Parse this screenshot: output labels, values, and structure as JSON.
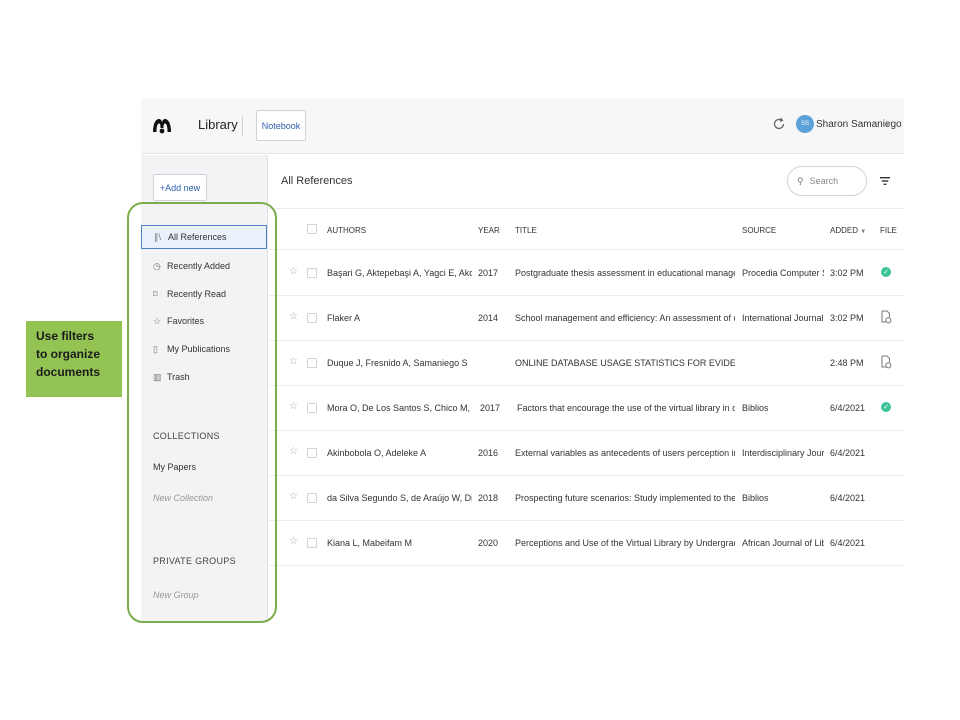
{
  "header": {
    "app_title": "Library",
    "notebook_label": "Notebook",
    "avatar_initials": "SS",
    "user_name": "Sharon Samaniego",
    "chevron": "∨"
  },
  "sidebar": {
    "add_new_label": "+Add new",
    "items": [
      {
        "label": "All References",
        "icon": "library-icon",
        "glyph": "∥\\"
      },
      {
        "label": "Recently Added",
        "icon": "clock-icon",
        "glyph": "◷"
      },
      {
        "label": "Recently Read",
        "icon": "bookmark-icon",
        "glyph": "⌑"
      },
      {
        "label": "Favorites",
        "icon": "star-icon",
        "glyph": "☆"
      },
      {
        "label": "My Publications",
        "icon": "document-icon",
        "glyph": "▯"
      },
      {
        "label": "Trash",
        "icon": "trash-icon",
        "glyph": "▥"
      }
    ],
    "collections_heading": "COLLECTIONS",
    "collections": [
      "My Papers"
    ],
    "new_collection": "New Collection",
    "groups_heading": "PRIVATE GROUPS",
    "new_group": "New Group"
  },
  "main": {
    "title": "All References",
    "search_placeholder": "Search",
    "columns": {
      "authors": "AUTHORS",
      "year": "YEAR",
      "title": "TITLE",
      "source": "SOURCE",
      "added": "ADDED",
      "added_sort": "▼",
      "file": "FILE"
    },
    "rows": [
      {
        "authors": "Başari G, Aktepebaşi A, Yagci E, Akdag S",
        "year": "2017",
        "title": "Postgraduate thesis assessment in educational management s...",
        "source": "Procedia Computer S...",
        "added": "3:02 PM",
        "file": "check"
      },
      {
        "authors": "Flaker A",
        "year": "2014",
        "title": "School management and efficiency: An assessment of charter ...",
        "source": "International Journal ...",
        "added": "3:02 PM",
        "file": "doc"
      },
      {
        "authors": "Duque J, Fresnido A, Samaniego S",
        "year": "",
        "title": "ONLINE DATABASE USAGE STATISTICS FOR EVIDENCED-...",
        "source": "",
        "added": "2:48 PM",
        "file": "doc"
      },
      {
        "authors": "Mora O, De Los Santos S, Chico M, Me...",
        "year": "2017",
        "title": "Factors that encourage the use of the virtual library in college ...",
        "source": "Biblios",
        "added": "6/4/2021",
        "file": "check"
      },
      {
        "authors": "Akinbobola O, Adeleke A",
        "year": "2016",
        "title": "External variables as antecedents of users perception in virtual...",
        "source": "Interdisciplinary Jour...",
        "added": "6/4/2021",
        "file": ""
      },
      {
        "authors": "da Silva Segundo S, de Araújo W, Dias G",
        "year": "2018",
        "title": "Prospecting future scenarios: Study implemented to the virtual ...",
        "source": "Biblios",
        "added": "6/4/2021",
        "file": ""
      },
      {
        "authors": "Kiana L, Mabeifam M",
        "year": "2020",
        "title": "Perceptions and Use of the Virtual Library by Undergraduates ...",
        "source": "African Journal of Lib...",
        "added": "6/4/2021",
        "file": ""
      }
    ]
  },
  "annotation": {
    "callout_lines": [
      "Use filters",
      "to organize",
      "documents"
    ],
    "accent": "#92c353"
  },
  "colors": {
    "link_blue": "#2c5fa8",
    "active_border": "#4d7fc4",
    "file_check": "#3cc39a"
  }
}
